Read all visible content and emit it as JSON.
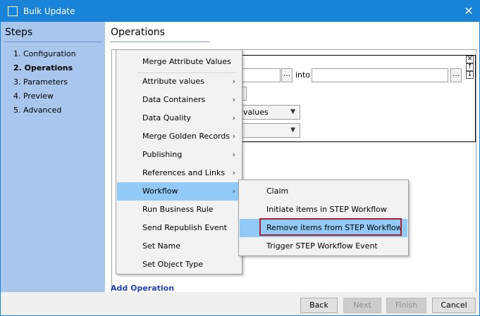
{
  "window": {
    "title": "Bulk Update",
    "icon": "window-icon",
    "close_glyph": "✕",
    "accent": "#1883d7"
  },
  "sidebar": {
    "heading": "Steps",
    "steps": [
      {
        "label": "1. Configuration",
        "active": false
      },
      {
        "label": "2. Operations",
        "active": true
      },
      {
        "label": "3. Parameters",
        "active": false
      },
      {
        "label": "4. Preview",
        "active": false
      },
      {
        "label": "5. Advanced",
        "active": false
      }
    ]
  },
  "main": {
    "heading": "Operations",
    "into_label": "into",
    "ellipsis": "...",
    "combo1_value": "values",
    "combo2_value": "",
    "add_operation": "Add Operation"
  },
  "context_menu": {
    "items": [
      {
        "label": "Merge Attribute Values",
        "has_submenu": false
      },
      {
        "label": "Attribute values",
        "has_submenu": true
      },
      {
        "label": "Data Containers",
        "has_submenu": true
      },
      {
        "label": "Data Quality",
        "has_submenu": true
      },
      {
        "label": "Merge Golden Records",
        "has_submenu": true
      },
      {
        "label": "Publishing",
        "has_submenu": true
      },
      {
        "label": "References and Links",
        "has_submenu": true
      },
      {
        "label": "Workflow",
        "has_submenu": true,
        "hover": true
      },
      {
        "label": "Run Business Rule",
        "has_submenu": false
      },
      {
        "label": "Send Republish Event",
        "has_submenu": false
      },
      {
        "label": "Set Name",
        "has_submenu": false
      },
      {
        "label": "Set Object Type",
        "has_submenu": false
      }
    ],
    "chevron": "›"
  },
  "workflow_submenu": {
    "items": [
      {
        "label": "Claim",
        "hover": false
      },
      {
        "label": "Initiate items in STEP Workflow",
        "hover": false
      },
      {
        "label": "Remove items from STEP Workflow",
        "hover": true
      },
      {
        "label": "Trigger STEP Workflow Event",
        "hover": false
      }
    ]
  },
  "footer": {
    "back": "Back",
    "next": "Next",
    "finish": "Finish",
    "cancel": "Cancel"
  }
}
